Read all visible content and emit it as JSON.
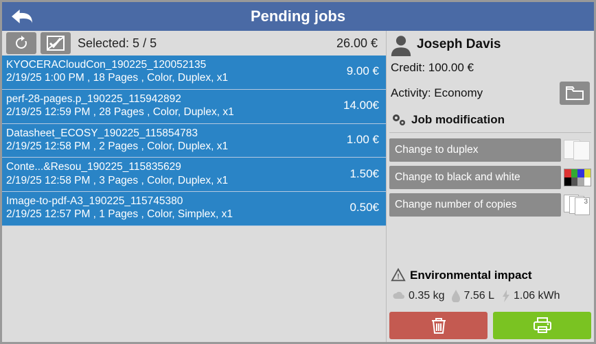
{
  "header": {
    "title": "Pending jobs"
  },
  "toolbar": {
    "selected_label": "Selected: 5 / 5",
    "total": "26.00 €"
  },
  "jobs": [
    {
      "name": "KYOCERACloudCon_190225_120052135",
      "meta": "2/19/25 1:00 PM , 18 Pages , Color, Duplex, x1",
      "price": "9.00 €"
    },
    {
      "name": "perf-28-pages.p_190225_115942892",
      "meta": "2/19/25 12:59 PM , 28 Pages , Color, Duplex, x1",
      "price": "14.00€"
    },
    {
      "name": "Datasheet_ECOSY_190225_115854783",
      "meta": "2/19/25 12:58 PM , 2 Pages , Color, Duplex, x1",
      "price": "1.00 €"
    },
    {
      "name": "Conte...&Resou_190225_115835629",
      "meta": "2/19/25 12:58 PM , 3 Pages , Color, Duplex, x1",
      "price": "1.50€"
    },
    {
      "name": "Image-to-pdf-A3_190225_115745380",
      "meta": "2/19/25 12:57 PM , 1 Pages , Color, Simplex, x1",
      "price": "0.50€"
    }
  ],
  "user": {
    "name": "Joseph Davis",
    "credit": "Credit: 100.00 €",
    "activity": "Activity: Economy"
  },
  "mods": {
    "heading": "Job modification",
    "duplex": "Change to duplex",
    "bw": "Change to black and white",
    "copies": "Change number of copies"
  },
  "env": {
    "heading": "Environmental impact",
    "co2": "0.35 kg",
    "water": "7.56 L",
    "energy": "1.06 kWh"
  }
}
